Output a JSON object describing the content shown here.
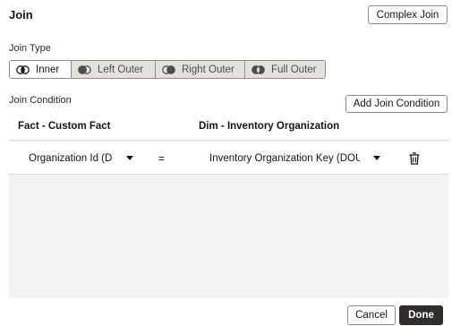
{
  "dialog": {
    "title": "Join",
    "complex_join_label": "Complex Join"
  },
  "join_type": {
    "label": "Join Type",
    "options": [
      {
        "label": "Inner",
        "selected": true
      },
      {
        "label": "Left Outer",
        "selected": false
      },
      {
        "label": "Right Outer",
        "selected": false
      },
      {
        "label": "Full Outer",
        "selected": false
      }
    ]
  },
  "join_condition": {
    "label": "Join Condition",
    "add_label": "Add Join Condition",
    "columns": [
      "Fact - Custom Fact",
      "Dim - Inventory Organization"
    ],
    "rows": [
      {
        "left": "Organization Id (DOUBLE)",
        "operator": "=",
        "right": "Inventory Organization Key (DOUBLE)"
      }
    ]
  },
  "footer": {
    "cancel_label": "Cancel",
    "done_label": "Done"
  },
  "colors": {
    "primary_button": "#312d2a",
    "segment_unselected": "#e4e1dd",
    "table_empty_bg": "#f4f3f1"
  }
}
